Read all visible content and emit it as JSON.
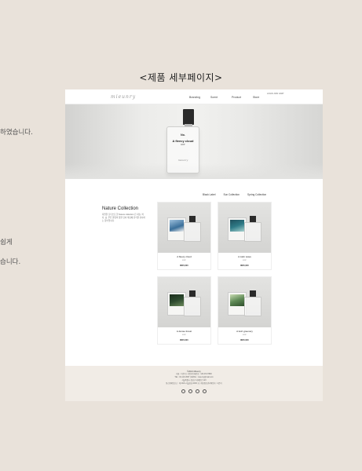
{
  "side_text": {
    "line1": "하였습니다.",
    "line2": "쉽게",
    "line3": "습니다."
  },
  "heading": "<제품 세부페이지>",
  "nav": {
    "logo": "mieunry",
    "menu": [
      "Branding",
      "Scent",
      "Product",
      "Store"
    ],
    "util": "LOGIN  JOIN  CART"
  },
  "hero": {
    "bottle_number": "No.",
    "bottle_name": "A fleecy cloud",
    "bottle_sub": "EDP",
    "bottle_logo": "mieunry"
  },
  "collection": {
    "tabs": [
      "Black Label",
      "Sun Collection",
      "Spring Collection"
    ],
    "title": "Nature Collection",
    "description": "자연을 모티브로 한 Nature collection 은 하늘, 바다, 숲, 푸른 풀잎의 향을 담아 마음에 휴식을 선사하는 향수입니다."
  },
  "products": [
    {
      "name": "A fleecy cloud",
      "sub": "EDP",
      "price": "₩45,000",
      "art": "#3a6f9a"
    },
    {
      "name": "A calm wave",
      "sub": "EDP",
      "price": "₩45,000",
      "art": "#2e7a86"
    },
    {
      "name": "A dense forest",
      "sub": "EDP",
      "price": "₩45,000",
      "art": "#2d4a2f"
    },
    {
      "name": "A lush greenery",
      "sub": "EDP",
      "price": "₩45,000",
      "art": "#5f8a56"
    }
  ],
  "footer": {
    "brand": "©2021 Mieunry",
    "line1": "대표 : 미은리 | 사업자등록번호 : 123-45-67890",
    "line2": "TEL : 02-123-4567 | EMAIL : mieunry@mail.com",
    "line3": "서울특별시 강남구 테헤란로 123",
    "line4": "통신판매업신고 : 제 2021-서울강남-0000 호 | 개인정보관리책임자 : 미은리"
  }
}
